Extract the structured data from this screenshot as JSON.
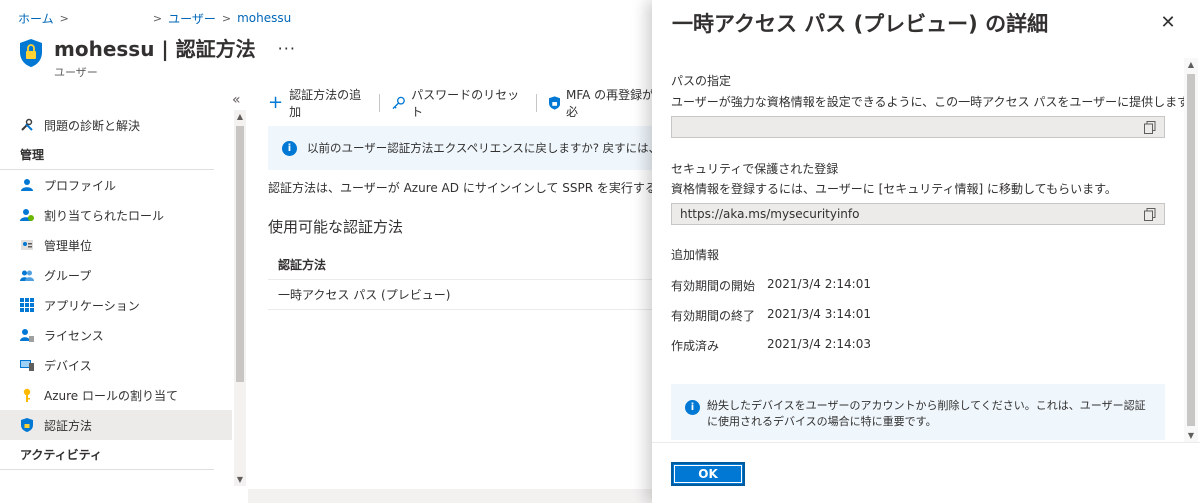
{
  "breadcrumb": {
    "home": "ホーム",
    "users": "ユーザー",
    "current": "mohessu"
  },
  "page": {
    "title": "mohessu | 認証方法",
    "subtitle": "ユーザー",
    "more": "···"
  },
  "sidebar": {
    "items_top": [
      {
        "label": "問題の診断と解決",
        "icon": "tools-icon"
      }
    ],
    "section_manage": "管理",
    "items_manage": [
      {
        "label": "プロファイル",
        "icon": "person-icon"
      },
      {
        "label": "割り当てられたロール",
        "icon": "person-role-icon"
      },
      {
        "label": "管理単位",
        "icon": "admin-unit-icon"
      },
      {
        "label": "グループ",
        "icon": "group-icon"
      },
      {
        "label": "アプリケーション",
        "icon": "apps-grid-icon"
      },
      {
        "label": "ライセンス",
        "icon": "license-icon"
      },
      {
        "label": "デバイス",
        "icon": "device-icon"
      },
      {
        "label": "Azure ロールの割り当て",
        "icon": "key-icon"
      },
      {
        "label": "認証方法",
        "icon": "shield-icon",
        "active": true
      }
    ],
    "section_activity": "アクティビティ"
  },
  "toolbar": {
    "add_method": "認証方法の追加",
    "reset_password": "パスワードのリセット",
    "mfa_reregister": "MFA の再登録が必"
  },
  "banner": {
    "text": "以前のユーザー認証方法エクスペリエンスに戻しますか? 戻すには、こちらをクリック"
  },
  "main": {
    "description": "認証方法は、ユーザーが Azure AD にサインインして SSPR を実行する方法です。",
    "available_title": "使用可能な認証方法",
    "table_header": "認証方法",
    "rows": [
      "一時アクセス パス (プレビュー)"
    ]
  },
  "blade": {
    "title": "一時アクセス パス (プレビュー) の詳細",
    "pass_label": "パスの指定",
    "pass_desc": "ユーザーが強力な資格情報を設定できるように、この一時アクセス パスをユーザーに提供します。",
    "pass_value": "",
    "secure_label": "セキュリティで保護された登録",
    "secure_desc": "資格情報を登録するには、ユーザーに [セキュリティ情報] に移動してもらいます。",
    "secure_url": "https://aka.ms/mysecurityinfo",
    "additional_label": "追加情報",
    "start_label": "有効期間の開始",
    "start_value": "2021/3/4 2:14:01",
    "end_label": "有効期間の終了",
    "end_value": "2021/3/4 3:14:01",
    "created_label": "作成済み",
    "created_value": "2021/3/4 2:14:03",
    "info_text": "紛失したデバイスをユーザーのアカウントから削除してください。これは、ユーザー認証に使用されるデバイスの場合に特に重要です。",
    "ok_label": "OK"
  },
  "colors": {
    "accent": "#0078d4",
    "info_bg": "#eff6fc",
    "active_bg": "#edebe9"
  }
}
